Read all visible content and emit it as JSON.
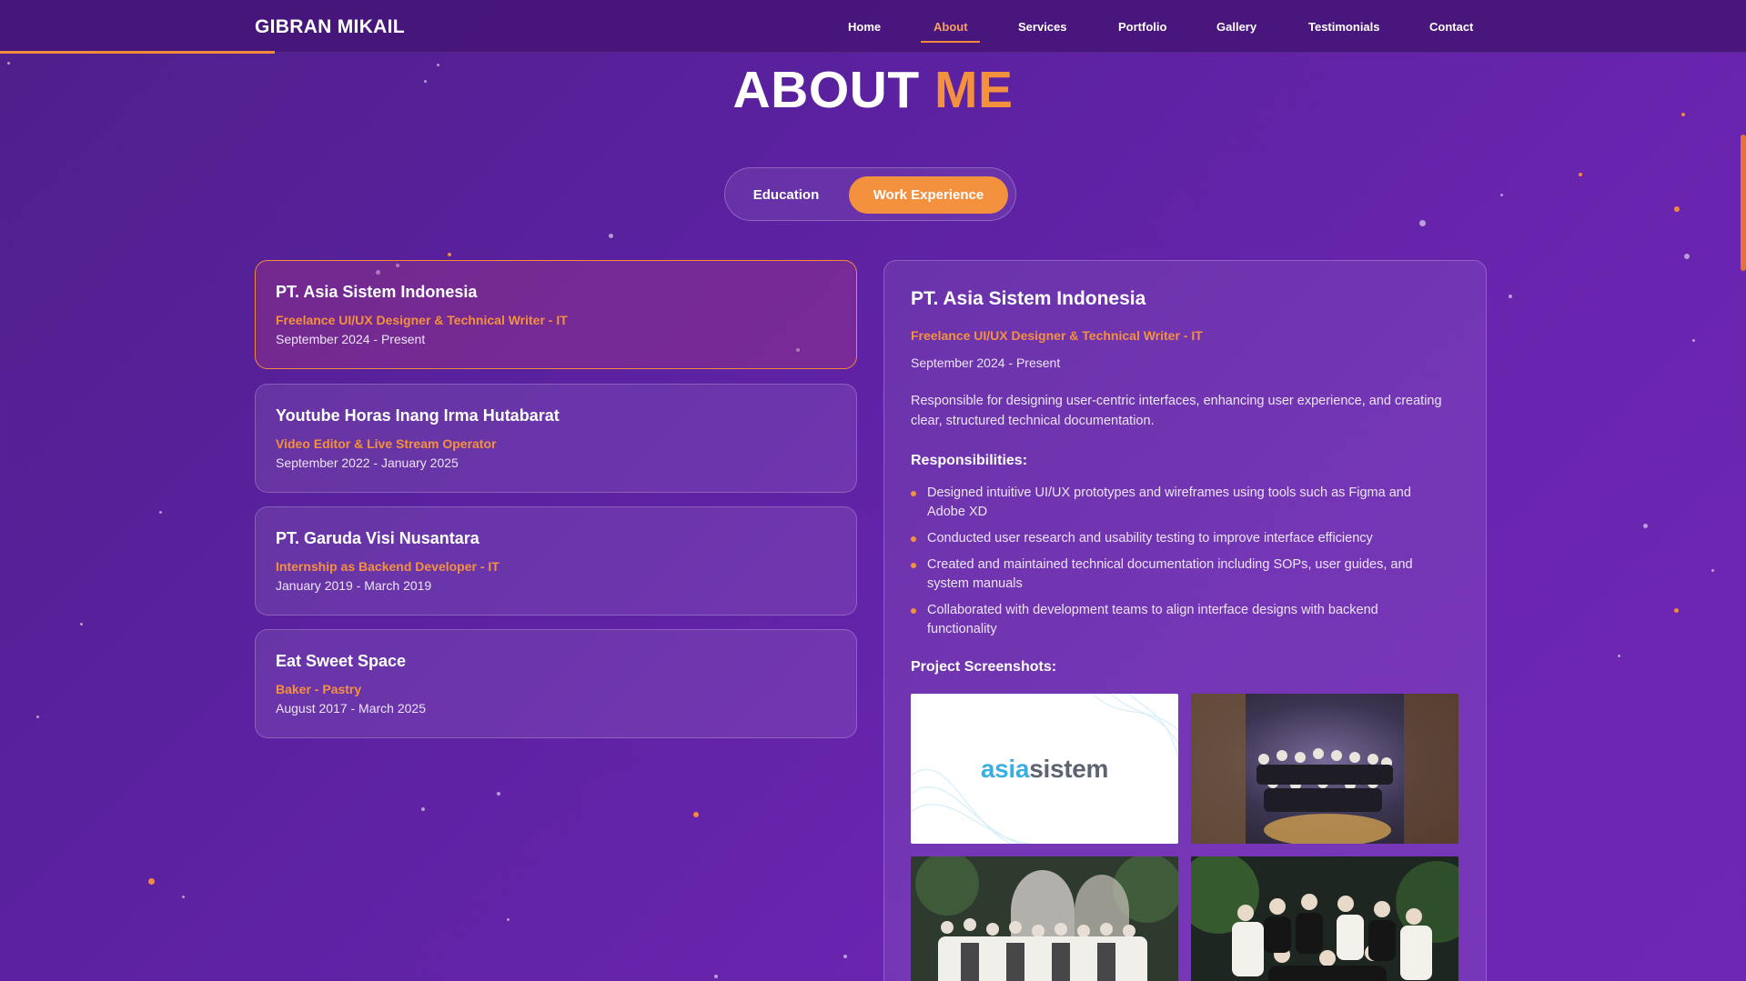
{
  "nav": {
    "brand": "GIBRAN MIKAIL",
    "links": [
      "Home",
      "About",
      "Services",
      "Portfolio",
      "Gallery",
      "Testimonials",
      "Contact"
    ],
    "active": "About"
  },
  "about": {
    "title_main": "ABOUT",
    "title_accent": "ME"
  },
  "tabs": {
    "education": "Education",
    "work": "Work Experience",
    "active": "Work Experience"
  },
  "experience": [
    {
      "company": "PT. Asia Sistem Indonesia",
      "role": "Freelance UI/UX Designer & Technical Writer - IT",
      "date": "September 2024 - Present"
    },
    {
      "company": "Youtube Horas Inang Irma Hutabarat",
      "role": "Video Editor & Live Stream Operator",
      "date": "September 2022 - January 2025"
    },
    {
      "company": "PT. Garuda Visi Nusantara",
      "role": "Internship as Backend Developer - IT",
      "date": "January 2019 - March 2019"
    },
    {
      "company": "Eat Sweet Space",
      "role": "Baker - Pastry",
      "date": "August 2017 - March 2025"
    }
  ],
  "detail": {
    "company": "PT. Asia Sistem Indonesia",
    "role": "Freelance UI/UX Designer & Technical Writer - IT",
    "date": "September 2024 - Present",
    "description": "Responsible for designing user-centric interfaces, enhancing user experience, and creating clear, structured technical documentation.",
    "responsibilities_heading": "Responsibilities:",
    "responsibilities": [
      "Designed intuitive UI/UX prototypes and wireframes using tools such as Figma and Adobe XD",
      "Conducted user research and usability testing to improve interface efficiency",
      "Created and maintained technical documentation including SOPs, user guides, and system manuals",
      "Collaborated with development teams to align interface designs with backend functionality"
    ],
    "screenshots_heading": "Project Screenshots:",
    "logo_asia": "asia",
    "logo_sistem": "sistem"
  },
  "colors": {
    "accent": "#f4913f",
    "background": "#5b21a0"
  }
}
